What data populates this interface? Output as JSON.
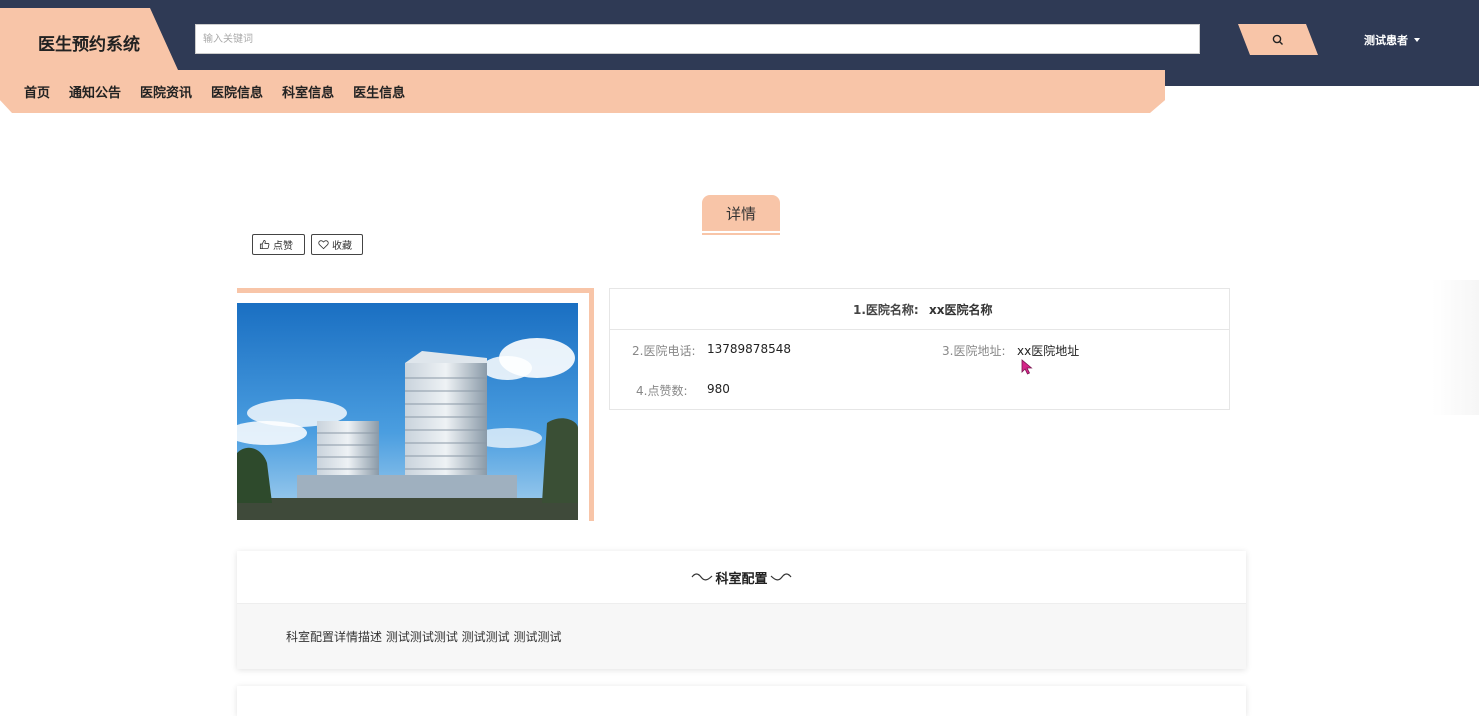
{
  "header": {
    "logo": "医生预约系统",
    "search_placeholder": "输入关键词",
    "user": "测试患者"
  },
  "nav": [
    "首页",
    "通知公告",
    "医院资讯",
    "医院信息",
    "科室信息",
    "医生信息"
  ],
  "detail": {
    "tab": "详情",
    "like_label": "点赞",
    "collect_label": "收藏"
  },
  "info": {
    "name_label": "1.医院名称:",
    "name_value": "xx医院名称",
    "phone_label": "2.医院电话:",
    "phone_value": "13789878548",
    "address_label": "3.医院地址:",
    "address_value": "xx医院地址",
    "likes_label": "4.点赞数:",
    "likes_value": "980"
  },
  "section": {
    "title": "科室配置",
    "content": "科室配置详情描述 测试测试测试 测试测试 测试测试"
  },
  "colors": {
    "header_bg": "#2f3a55",
    "accent": "#f8c5a8"
  },
  "icons": [
    "search-icon",
    "thumbs-up-icon",
    "heart-icon",
    "caret-down-icon",
    "mouse-cursor-icon"
  ]
}
